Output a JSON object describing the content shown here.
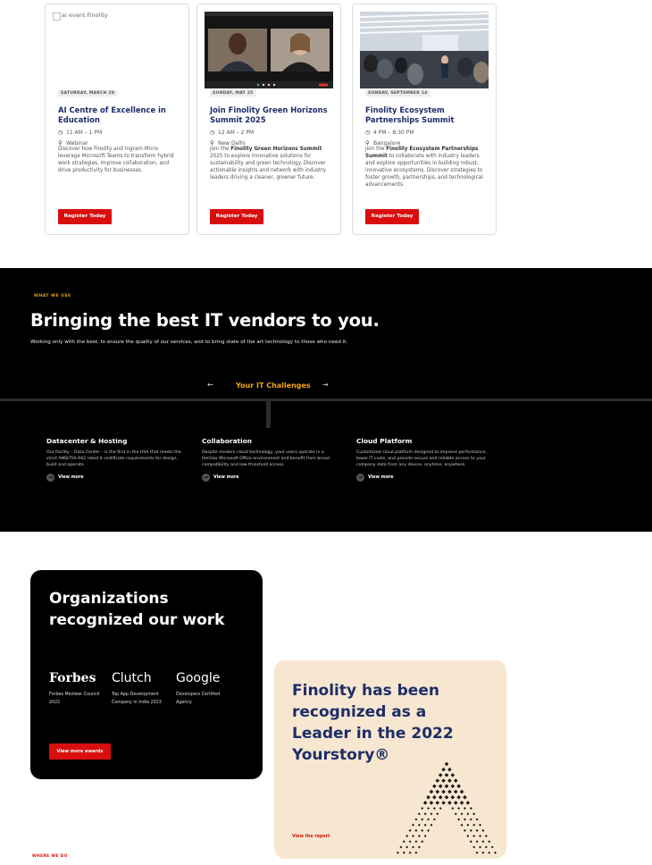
{
  "events": {
    "cards": [
      {
        "image_alt": "ai event Finolity",
        "date": "SATURDAY, MARCH 29",
        "title": "AI Centre of Excellence in Education",
        "time": "11 AM – 1 PM",
        "location": "Webinar",
        "description": "Discover how Finolity and Ingram Micro leverage Microsoft Teams to transform hybrid work strategies, improve collaboration, and drive productivity for businesses.",
        "button": "Register Today"
      },
      {
        "date": "SUNDAY, MAY 25",
        "title": "Join Finolity Green Horizons Summit 2025",
        "time": "12 AM – 2 PM",
        "location": "New Delhi",
        "description_pre": "Join the ",
        "description_bold": "Finolity Green Horizons Summit",
        "description_post": " 2025 to explore innovative solutions for sustainability and green technology. Discover actionable insights and network with industry leaders driving a cleaner, greener future.",
        "button": "Register Today"
      },
      {
        "date": "SUNDAY, SEPTEMBER 14",
        "title": "Finolity Ecosystem Partnerships Summit",
        "time": "4 PM – 8:30 PM",
        "location": "Bangalore",
        "description_pre": "Join the ",
        "description_bold": "Finolity Ecosystem Partnerships Summit",
        "description_post": " to collaborate with industry leaders and explore opportunities in building robust, innovative ecosystems. Discover strategies to foster growth, partnerships, and technological advancements.",
        "button": "Register Today"
      }
    ]
  },
  "vendors": {
    "eyebrow": "WHAT WE USE",
    "heading": "Bringing the best IT vendors to you.",
    "subtitle": "Working only with the best, to ensure the quality of our services, and to bring state of the art technology to those who need it.",
    "tab_label": "Your IT Challenges",
    "prev_arrow": "←",
    "next_arrow": "→",
    "services": [
      {
        "title": "Datacenter & Hosting",
        "description": "Our facility – Data Center – is the first in the USA that meets the strict ANSI/TIA-942 rated 4 certificate requirements for design, build and operate.",
        "link": "View more"
      },
      {
        "title": "Collaboration",
        "description": "Despite modern cloud technology, your users operate in a familiar Microsoft Office environment and benefit from broad compatibility and low-threshold access.",
        "link": "View more"
      },
      {
        "title": "Cloud Platform",
        "description": "Customized cloud platform designed to improve performance, lower IT costs, and provide secure and reliable access to your company data from any device, anytime, anywhere.",
        "link": "View more"
      }
    ]
  },
  "recognition": {
    "heading": "Organizations recognized our work",
    "brands": [
      {
        "name": "Forbes",
        "caption": "Forbes Member Council 2022"
      },
      {
        "name": "Clutch",
        "caption": "Top App Development Company in India 2023"
      },
      {
        "name": "Google",
        "caption": "Developers Certified Agency"
      }
    ],
    "awards_button": "View more awards",
    "story_heading": "Finolity has been recognized as a Leader in the 2022 Yourstory®",
    "story_link": "View the report",
    "next_section_label": "WHERE WE DO"
  },
  "colors": {
    "brand_red": "#d90e0e",
    "navy": "#1d2d68",
    "accent_orange": "#f3a712",
    "cream": "#f7e7d0"
  }
}
